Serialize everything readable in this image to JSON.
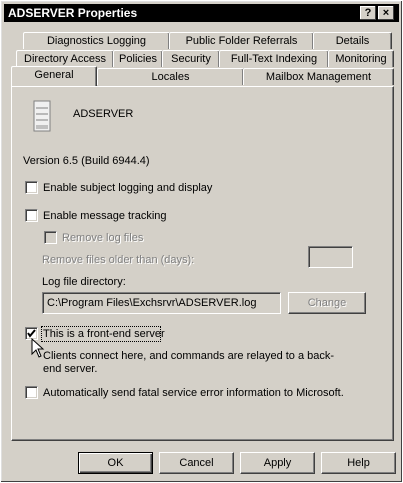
{
  "window": {
    "title": "ADSERVER Properties",
    "help_button": "?",
    "close_button": "×"
  },
  "tabs": {
    "row1": [
      "Diagnostics Logging",
      "Public Folder Referrals",
      "Details"
    ],
    "row2": [
      "Directory Access",
      "Policies",
      "Security",
      "Full-Text Indexing",
      "Monitoring"
    ],
    "row3": [
      "General",
      "Locales",
      "Mailbox Management"
    ],
    "selected": "General"
  },
  "general": {
    "server_name": "ADSERVER",
    "version": "Version 6.5 (Build 6944.4)",
    "subject_logging": {
      "label": "Enable subject logging and display",
      "checked": false
    },
    "message_tracking": {
      "label": "Enable message tracking",
      "checked": false
    },
    "remove_log_files": {
      "label": "Remove log files",
      "checked": false,
      "enabled": false
    },
    "remove_older_label": "Remove files older than (days):",
    "remove_older_value": "",
    "log_dir_label": "Log file directory:",
    "log_dir_value": "C:\\Program Files\\Exchsrvr\\ADSERVER.log",
    "change_button": "Change",
    "front_end": {
      "label": "This is a front-end server",
      "checked": true
    },
    "front_end_desc": "Clients connect here, and commands are relayed to a back-end server.",
    "fatal_error": {
      "label": "Automatically send fatal service error information to Microsoft.",
      "checked": false
    }
  },
  "buttons": {
    "ok": "OK",
    "cancel": "Cancel",
    "apply": "Apply",
    "help": "Help"
  }
}
